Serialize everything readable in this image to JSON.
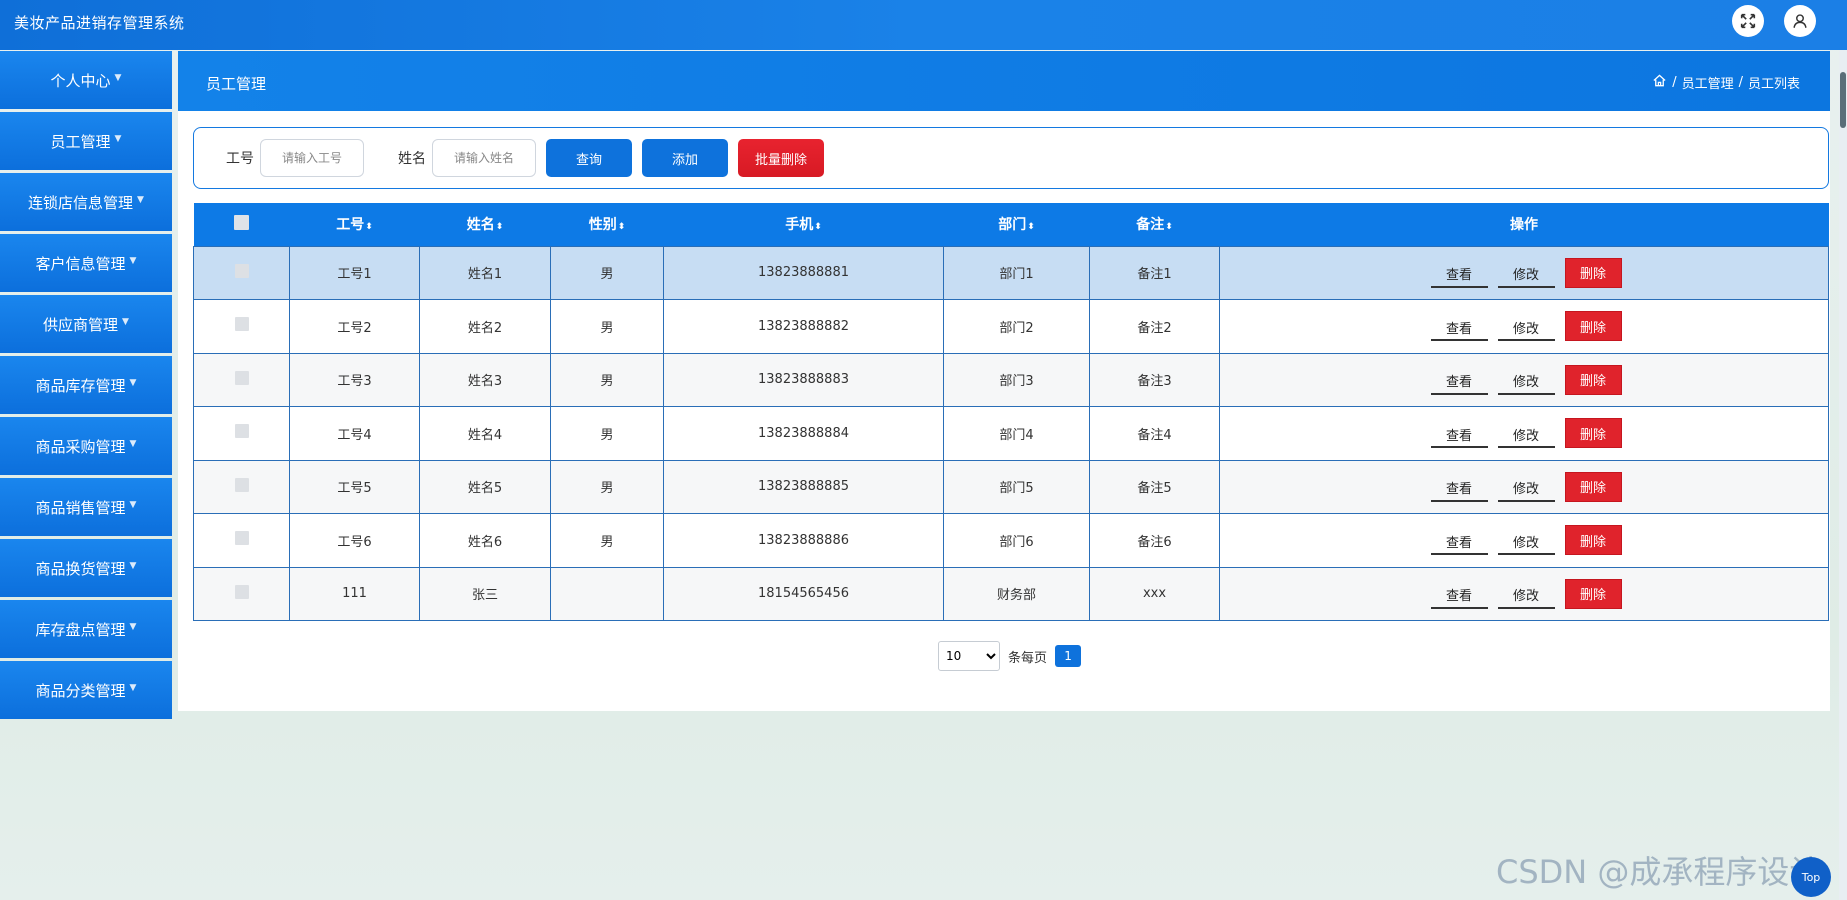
{
  "app": {
    "title": "美妆产品进销存管理系统"
  },
  "topbar": {
    "fullscreen_icon": "fullscreen-icon",
    "user_icon": "user-icon"
  },
  "sidebar": {
    "items": [
      {
        "label": "个人中心"
      },
      {
        "label": "员工管理"
      },
      {
        "label": "连锁店信息管理"
      },
      {
        "label": "客户信息管理"
      },
      {
        "label": "供应商管理"
      },
      {
        "label": "商品库存管理"
      },
      {
        "label": "商品采购管理"
      },
      {
        "label": "商品销售管理"
      },
      {
        "label": "商品换货管理"
      },
      {
        "label": "库存盘点管理"
      },
      {
        "label": "商品分类管理"
      }
    ]
  },
  "page": {
    "title": "员工管理",
    "breadcrumb": {
      "sep": "/",
      "level1": "员工管理",
      "level2": "员工列表"
    }
  },
  "search": {
    "id_label": "工号",
    "id_placeholder": "请输入工号",
    "name_label": "姓名",
    "name_placeholder": "请输入姓名",
    "query_button": "查询",
    "add_button": "添加",
    "batch_delete_button": "批量删除"
  },
  "table": {
    "columns": [
      "工号",
      "姓名",
      "性别",
      "手机",
      "部门",
      "备注",
      "操作"
    ],
    "sort_glyph": "⬍",
    "rows": [
      {
        "id": "工号1",
        "name": "姓名1",
        "gender": "男",
        "phone": "13823888881",
        "dept": "部门1",
        "note": "备注1"
      },
      {
        "id": "工号2",
        "name": "姓名2",
        "gender": "男",
        "phone": "13823888882",
        "dept": "部门2",
        "note": "备注2"
      },
      {
        "id": "工号3",
        "name": "姓名3",
        "gender": "男",
        "phone": "13823888883",
        "dept": "部门3",
        "note": "备注3"
      },
      {
        "id": "工号4",
        "name": "姓名4",
        "gender": "男",
        "phone": "13823888884",
        "dept": "部门4",
        "note": "备注4"
      },
      {
        "id": "工号5",
        "name": "姓名5",
        "gender": "男",
        "phone": "13823888885",
        "dept": "部门5",
        "note": "备注5"
      },
      {
        "id": "工号6",
        "name": "姓名6",
        "gender": "男",
        "phone": "13823888886",
        "dept": "部门6",
        "note": "备注6"
      },
      {
        "id": "111",
        "name": "张三",
        "gender": "",
        "phone": "18154565456",
        "dept": "财务部",
        "note": "xxx"
      }
    ],
    "actions": {
      "view": "查看",
      "edit": "修改",
      "delete": "删除"
    }
  },
  "pager": {
    "page_size": "10",
    "per_page_label": "条每页",
    "current_page": "1"
  },
  "watermark": "CSDN @成承程序设计",
  "back_to_top": "Top",
  "colors": {
    "primary": "#0e72dc",
    "danger": "#e0232c",
    "row_highlight": "#c7ddf3"
  }
}
